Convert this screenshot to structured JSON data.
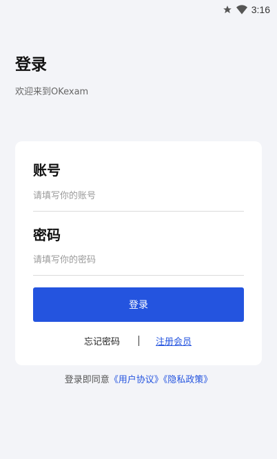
{
  "status_bar": {
    "time": "3:16",
    "icons": [
      "star-icon",
      "wifi-icon"
    ]
  },
  "header": {
    "title": "登录",
    "subtitle": "欢迎来到OKexam"
  },
  "form": {
    "account_label": "账号",
    "account_placeholder": "请填写你的账号",
    "account_value": "",
    "password_label": "密码",
    "password_placeholder": "请填写你的密码",
    "password_value": "",
    "login_button": "登录",
    "forgot_password": "忘记密码",
    "register": "注册会员"
  },
  "agreement": {
    "prefix": "登录即同意",
    "user_agreement": "《用户协议》",
    "privacy_policy": "《隐私政策》"
  },
  "colors": {
    "accent": "#2454df",
    "background": "#f3f4f8",
    "card": "#ffffff"
  }
}
